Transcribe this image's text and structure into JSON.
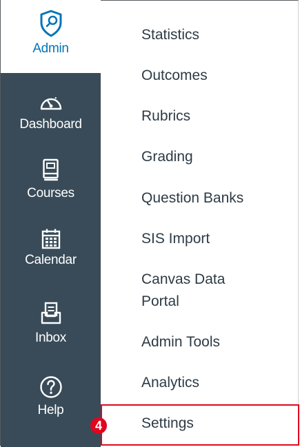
{
  "global_nav": {
    "items": [
      {
        "label": "Admin",
        "icon": "admin-shield-icon",
        "active": true
      },
      {
        "label": "Dashboard",
        "icon": "dashboard-icon"
      },
      {
        "label": "Courses",
        "icon": "courses-book-icon"
      },
      {
        "label": "Calendar",
        "icon": "calendar-icon"
      },
      {
        "label": "Inbox",
        "icon": "inbox-icon"
      },
      {
        "label": "Help",
        "icon": "help-question-icon"
      }
    ],
    "colors": {
      "background": "#394b58",
      "active_text": "#0374b5",
      "text": "#ffffff"
    }
  },
  "admin_menu": {
    "items": [
      "Statistics",
      "Outcomes",
      "Rubrics",
      "Grading",
      "Question Banks",
      "SIS Import",
      "Canvas Data Portal",
      "Admin Tools",
      "Analytics",
      "Settings"
    ],
    "canvas_data_line1": "Canvas Data",
    "canvas_data_line2": "Portal",
    "highlighted": "Settings"
  },
  "annotation": {
    "step": "4",
    "color": "#e0061f"
  }
}
